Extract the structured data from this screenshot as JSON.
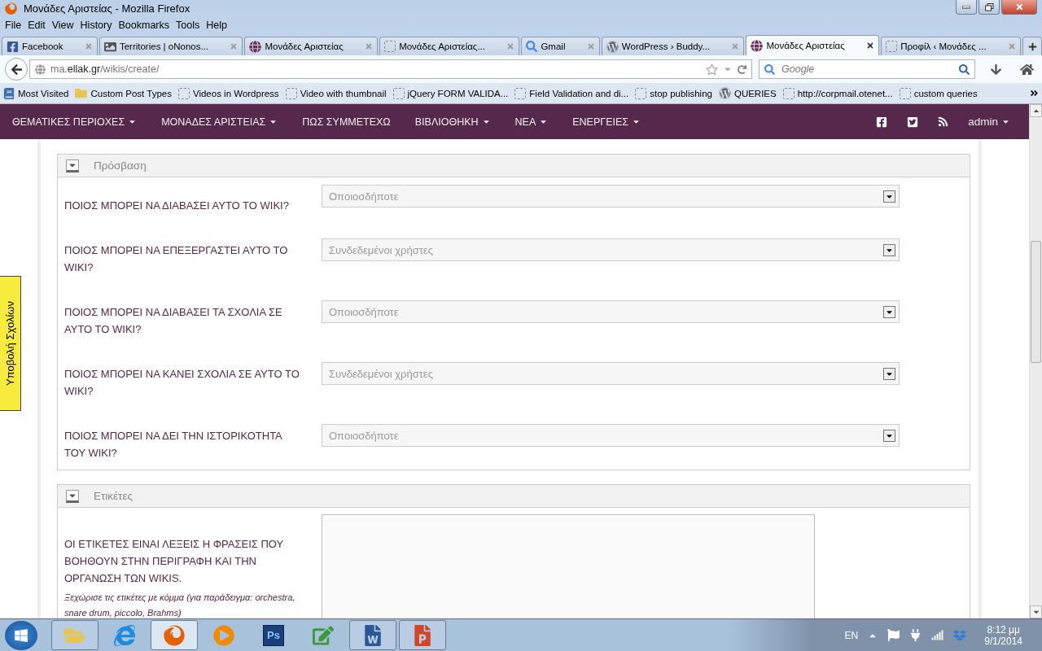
{
  "window": {
    "title": "Μονάδες Αριστείας - Mozilla Firefox"
  },
  "menu": [
    "File",
    "Edit",
    "View",
    "History",
    "Bookmarks",
    "Tools",
    "Help"
  ],
  "tabs": [
    {
      "label": "Facebook",
      "kind": "facebook",
      "selected": false
    },
    {
      "label": "Territories | oNonos...",
      "kind": "image",
      "selected": false
    },
    {
      "label": "Μονάδες Αριστείας",
      "kind": "site",
      "selected": false
    },
    {
      "label": "Μονάδες Αριστείας...",
      "kind": "blank",
      "selected": false
    },
    {
      "label": "Gmail",
      "kind": "google",
      "selected": false
    },
    {
      "label": "WordPress › Buddy...",
      "kind": "wordpress",
      "selected": false
    },
    {
      "label": "Μονάδες Αριστείας",
      "kind": "site",
      "selected": true
    },
    {
      "label": "Προφίλ ‹ Μονάδες ...",
      "kind": "blank",
      "selected": false
    }
  ],
  "address": {
    "subdomain": "ma.",
    "domain": "ellak.gr",
    "path": "/wikis/create/"
  },
  "search": {
    "placeholder": "Google"
  },
  "bookmarks": [
    {
      "label": "Most Visited",
      "kind": "library"
    },
    {
      "label": "Custom Post Types",
      "kind": "folder"
    },
    {
      "label": "Videos in Wordpress",
      "kind": "blank"
    },
    {
      "label": "Video with thumbnail",
      "kind": "blank"
    },
    {
      "label": "jQuery FORM VALIDA...",
      "kind": "blank"
    },
    {
      "label": "Field Validation and di...",
      "kind": "blank"
    },
    {
      "label": "stop publishing",
      "kind": "blank"
    },
    {
      "label": "QUERIES",
      "kind": "wordpress"
    },
    {
      "label": "http://corpmail.otenet...",
      "kind": "blank"
    },
    {
      "label": "custom queries",
      "kind": "blank"
    }
  ],
  "site_nav": {
    "items": [
      {
        "label": "ΘΕΜΑΤΙΚΕΣ ΠΕΡΙΟΧΕΣ",
        "dropdown": true
      },
      {
        "label": "ΜΟΝΑΔΕΣ ΑΡΙΣΤΕΙΑΣ",
        "dropdown": true
      },
      {
        "label": "ΠΩΣ ΣΥΜΜΕΤΕΧΩ",
        "dropdown": false
      },
      {
        "label": "ΒΙΒΛΙΟΘΗΚΗ",
        "dropdown": true
      },
      {
        "label": "ΝΕΑ",
        "dropdown": true
      },
      {
        "label": "ΕΝΕΡΓΕΙΕΣ",
        "dropdown": true
      }
    ],
    "social": [
      {
        "kind": "facebook"
      },
      {
        "kind": "twitter"
      },
      {
        "kind": "rss"
      }
    ],
    "user": {
      "label": "admin",
      "dropdown": true
    }
  },
  "feedback_tab": {
    "label": "Υποβολή Σχολίων"
  },
  "sections": [
    {
      "title": "Πρόσβαση",
      "kind": "selects",
      "rows": [
        {
          "label": "ΠΟΙΟΣ ΜΠΟΡΕΙ ΝΑ ΔΙΑΒΑΣΕΙ ΑΥΤΟ ΤΟ WIKI?",
          "value": "Οποιοσδήποτε"
        },
        {
          "label": "ΠΟΙΟΣ ΜΠΟΡΕΙ ΝΑ ΕΠΕΞΕΡΓΑΣΤΕΙ ΑΥΤΟ ΤΟ WIKI?",
          "value": "Συνδεδεμένοι χρήστες"
        },
        {
          "label": "ΠΟΙΟΣ ΜΠΟΡΕΙ ΝΑ ΔΙΑΒΑΣΕΙ ΤΑ ΣΧΟΛΙΑ ΣΕ ΑΥΤΟ ΤΟ WIKI?",
          "value": "Οποιοσδήποτε"
        },
        {
          "label": "ΠΟΙΟΣ ΜΠΟΡΕΙ ΝΑ ΚΑΝΕΙ ΣΧΟΛΙΑ ΣΕ ΑΥΤΟ ΤΟ WIKI?",
          "value": "Συνδεδεμένοι χρήστες"
        },
        {
          "label": "ΠΟΙΟΣ ΜΠΟΡΕΙ ΝΑ ΔΕΙ ΤΗΝ ΙΣΤΟΡΙΚΟΤΗΤΑ ΤΟΥ WIKI?",
          "value": "Οποιοσδήποτε"
        }
      ]
    },
    {
      "title": "Ετικέτες",
      "kind": "textarea",
      "label": "ΟΙ ΕΤΙΚΕΤΕΣ ΕΙΝΑΙ ΛΕΞΕΙΣ Η ΦΡΑΣΕΙΣ ΠΟΥ ΒΟΗΘΟΥΝ ΣΤΗΝ ΠΕΡΙΓΡΑΦΗ ΚΑΙ ΤΗΝ ΟΡΓΑΝΩΣΗ ΤΩΝ WIKIS.",
      "hint": "Ξεχώρισε τις ετικέτες με κόμμα (για παράδειγμα: orchestra, snare drum, piccolo, Brahms)"
    }
  ],
  "taskbar": {
    "apps": [
      {
        "kind": "explorer",
        "running": true,
        "selected": false
      },
      {
        "kind": "ie",
        "running": false,
        "selected": false
      },
      {
        "kind": "firefox",
        "running": true,
        "selected": true
      },
      {
        "kind": "media",
        "running": false,
        "selected": false
      },
      {
        "kind": "photoshop",
        "running": false,
        "selected": false,
        "text": "Ps"
      },
      {
        "kind": "notepad",
        "running": false,
        "selected": false
      },
      {
        "kind": "word",
        "running": true,
        "selected": false
      },
      {
        "kind": "powerpoint",
        "running": true,
        "selected": false
      }
    ],
    "language": "EN",
    "time": "8:12 μμ",
    "date": "9/1/2014"
  }
}
